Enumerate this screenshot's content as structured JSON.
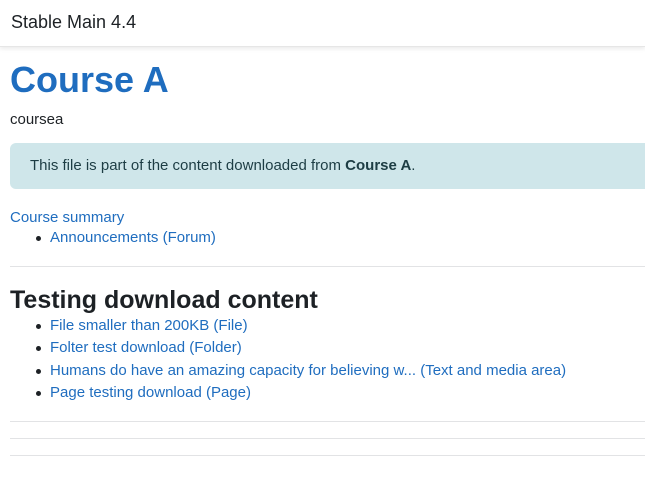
{
  "header": {
    "site_name": "Stable Main 4.4"
  },
  "course": {
    "title": "Course A",
    "shortname": "coursea"
  },
  "notice": {
    "prefix": "This file is part of the content downloaded from ",
    "course_name": "Course A",
    "suffix": "."
  },
  "summary": {
    "link_label": "Course summary",
    "items": [
      {
        "label": "Announcements (Forum)"
      }
    ]
  },
  "section": {
    "heading": "Testing download content",
    "items": [
      {
        "label": "File smaller than 200KB (File)"
      },
      {
        "label": "Folter test download (Folder)"
      },
      {
        "label": "Humans do have an amazing capacity for believing w... (Text and media area)"
      },
      {
        "label": "Page testing download (Page)"
      }
    ]
  },
  "colors": {
    "link": "#1f6dbf",
    "alert_background": "#cfe6ea"
  }
}
